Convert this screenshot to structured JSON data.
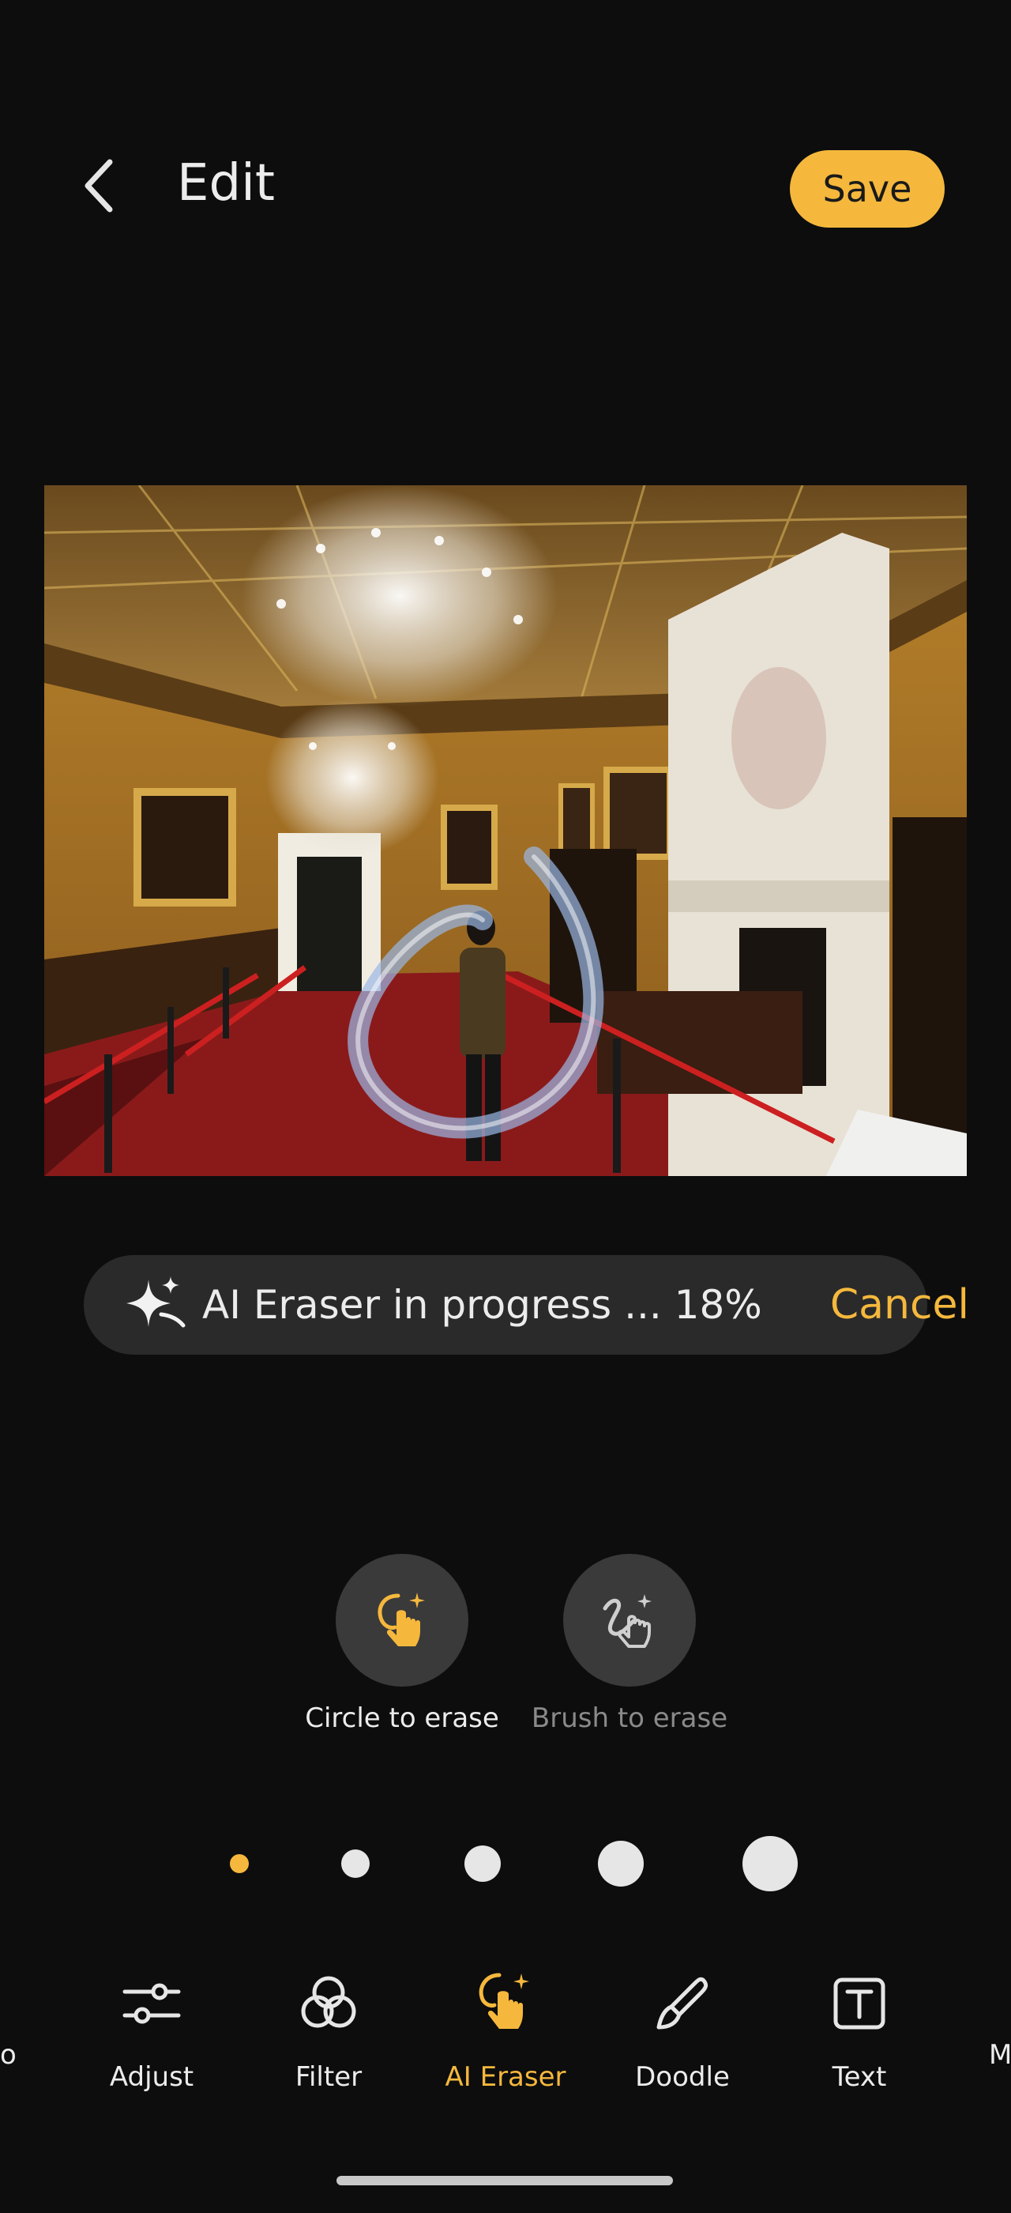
{
  "header": {
    "title": "Edit",
    "save_label": "Save"
  },
  "progress": {
    "text": "AI Eraser in progress ... 18%",
    "percent": 18,
    "cancel_label": "Cancel"
  },
  "modes": [
    {
      "label": "Circle to erase",
      "active": true
    },
    {
      "label": "Brush to erase",
      "active": false
    }
  ],
  "brush_sizes": {
    "count": 5,
    "selected_index": 0
  },
  "toolbar": {
    "partial_left": "o",
    "items": [
      {
        "label": "Adjust",
        "icon": "sliders-icon"
      },
      {
        "label": "Filter",
        "icon": "filter-circles-icon"
      },
      {
        "label": "AI Eraser",
        "icon": "ai-eraser-icon",
        "active": true
      },
      {
        "label": "Doodle",
        "icon": "brush-icon"
      },
      {
        "label": "Text",
        "icon": "text-box-icon"
      }
    ],
    "partial_right": "M"
  },
  "colors": {
    "accent": "#f5b83d",
    "background": "#0d0d0d",
    "pill": "#2a2a2a",
    "circle_bg": "#3a3a3a"
  }
}
